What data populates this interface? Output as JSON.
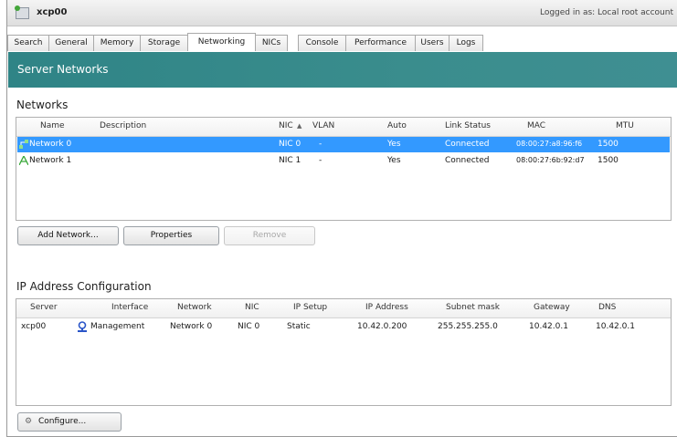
{
  "window": {
    "title": "xcp00",
    "login": "Logged in as: Local root account"
  },
  "tabs": [
    "Search",
    "General",
    "Memory",
    "Storage",
    "Networking",
    "NICs",
    "Console",
    "Performance",
    "Users",
    "Logs"
  ],
  "active_tab": "Networking",
  "banner": {
    "title": "Server Networks"
  },
  "networks": {
    "title": "Networks",
    "columns": [
      "Name",
      "Description",
      "NIC",
      "VLAN",
      "Auto",
      "Link Status",
      "MAC",
      "MTU"
    ],
    "rows": [
      {
        "name": "Network 0",
        "description": "",
        "nic": "NIC 0",
        "vlan": "-",
        "auto": "Yes",
        "link_status": "Connected",
        "mac": "08:00:27:a8:96:f6",
        "mtu": "1500",
        "selected": true
      },
      {
        "name": "Network 1",
        "description": "",
        "nic": "NIC 1",
        "vlan": "-",
        "auto": "Yes",
        "link_status": "Connected",
        "mac": "08:00:27:6b:92:d7",
        "mtu": "1500",
        "selected": false
      }
    ],
    "buttons": {
      "add": "Add Network...",
      "properties": "Properties",
      "remove": "Remove"
    }
  },
  "ip_config": {
    "title": "IP Address Configuration",
    "columns": [
      "Server",
      "Interface",
      "Network",
      "NIC",
      "IP Setup",
      "IP Address",
      "Subnet mask",
      "Gateway",
      "DNS"
    ],
    "rows": [
      {
        "server": "xcp00",
        "interface": "Management",
        "network": "Network 0",
        "nic": "NIC 0",
        "ip_setup": "Static",
        "ip_address": "10.42.0.200",
        "subnet_mask": "255.255.255.0",
        "gateway": "10.42.0.1",
        "dns": "10.42.0.1"
      }
    ],
    "configure_button": "Configure..."
  },
  "colors": {
    "banner": "#3a8d8d",
    "selection": "#3399ff"
  }
}
